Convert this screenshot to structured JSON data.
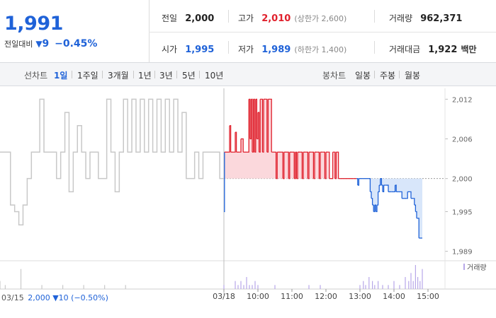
{
  "quote": {
    "price": "1,991",
    "change_label": "전일대비",
    "change_symbol": "▼",
    "change_value": "9",
    "change_percent": "−0.45%",
    "stats": [
      {
        "label": "전일",
        "value": "2,000",
        "value_color": "#222222",
        "extra": ""
      },
      {
        "label": "고가",
        "value": "2,010",
        "value_color": "#e0202c",
        "extra": "(상한가 2,600)"
      },
      {
        "label": "거래량",
        "value": "962,371",
        "value_color": "#222222",
        "extra": ""
      },
      {
        "label": "시가",
        "value": "1,995",
        "value_color": "#1f62d8",
        "extra": ""
      },
      {
        "label": "저가",
        "value": "1,989",
        "value_color": "#1f62d8",
        "extra": "(하한가 1,400)"
      },
      {
        "label": "거래대금",
        "value": "1,922",
        "value_color": "#222222",
        "extra": "백만"
      }
    ]
  },
  "line_chart_tabs": {
    "label": "선차트",
    "items": [
      "1일",
      "1주일",
      "3개월",
      "1년",
      "3년",
      "5년",
      "10년"
    ],
    "selected": "1일"
  },
  "candle_chart_tabs": {
    "label": "봉차트",
    "items": [
      "일봉",
      "주봉",
      "월봉"
    ]
  },
  "prev_day_info": {
    "date": "03/15",
    "close": "2,000",
    "change": "▼10",
    "change_percent": "(−0.50%)"
  },
  "colors": {
    "up": "#e0202c",
    "down": "#1f62d8",
    "prev_day_line": "#c8c8c8",
    "up_fill": "#fbd8dc",
    "down_fill": "#d8e6fa",
    "volume_bar": "#b7a7e8"
  },
  "chart_data": {
    "type": "line",
    "y_ticks": [
      "2,012",
      "2,006",
      "2,000",
      "1,995",
      "1,989"
    ],
    "y_tick_values": [
      2012,
      2006,
      2000,
      1995,
      1989
    ],
    "ylim": [
      1988,
      2013
    ],
    "x_ticks": [
      "03/18",
      "10:00",
      "11:00",
      "12:00",
      "13:00",
      "14:00",
      "15:00"
    ],
    "x_tick_minutes": [
      0,
      60,
      120,
      180,
      240,
      300,
      360
    ],
    "xlim_minutes": [
      0,
      390
    ],
    "reference_price": 2000,
    "volume_legend": "거래량",
    "previous_day_series": {
      "date": "03/15",
      "points": [
        [
          0,
          2004
        ],
        [
          6,
          2004
        ],
        [
          10,
          1996
        ],
        [
          14,
          1995
        ],
        [
          18,
          1993
        ],
        [
          22,
          1996
        ],
        [
          26,
          2000
        ],
        [
          30,
          2004
        ],
        [
          34,
          2004
        ],
        [
          38,
          2012
        ],
        [
          42,
          2004
        ],
        [
          46,
          2004
        ],
        [
          50,
          2004
        ],
        [
          54,
          2000
        ],
        [
          58,
          2004
        ],
        [
          62,
          2010
        ],
        [
          66,
          1998
        ],
        [
          70,
          2004
        ],
        [
          74,
          2008
        ],
        [
          78,
          2004
        ],
        [
          82,
          2000
        ],
        [
          86,
          2004
        ],
        [
          90,
          2004
        ],
        [
          94,
          2000
        ],
        [
          98,
          2000
        ],
        [
          102,
          2012
        ],
        [
          106,
          2004
        ],
        [
          110,
          1998
        ],
        [
          114,
          2004
        ],
        [
          118,
          2012
        ],
        [
          122,
          2004
        ],
        [
          126,
          2012
        ],
        [
          130,
          2004
        ],
        [
          134,
          2012
        ],
        [
          138,
          2004
        ],
        [
          142,
          2012
        ],
        [
          146,
          2004
        ],
        [
          150,
          2012
        ],
        [
          154,
          2004
        ],
        [
          158,
          2012
        ],
        [
          162,
          2004
        ],
        [
          166,
          2012
        ],
        [
          170,
          2004
        ],
        [
          174,
          2010
        ],
        [
          178,
          2000
        ],
        [
          182,
          2000
        ],
        [
          186,
          2004
        ],
        [
          190,
          2000
        ],
        [
          194,
          2004
        ],
        [
          198,
          2004
        ],
        [
          202,
          2004
        ],
        [
          206,
          2004
        ],
        [
          210,
          2000
        ],
        [
          214,
          2000
        ]
      ]
    },
    "today_series": {
      "date": "03/18",
      "points": [
        [
          0,
          1995
        ],
        [
          1,
          2004
        ],
        [
          8,
          2004
        ],
        [
          10,
          2008
        ],
        [
          12,
          2004
        ],
        [
          18,
          2004
        ],
        [
          20,
          2007
        ],
        [
          22,
          2004
        ],
        [
          28,
          2004
        ],
        [
          30,
          2006
        ],
        [
          34,
          2004
        ],
        [
          40,
          2004
        ],
        [
          44,
          2012
        ],
        [
          46,
          2006
        ],
        [
          48,
          2012
        ],
        [
          50,
          2004
        ],
        [
          52,
          2012
        ],
        [
          54,
          2004
        ],
        [
          56,
          2012
        ],
        [
          58,
          2006
        ],
        [
          60,
          2010
        ],
        [
          62,
          2004
        ],
        [
          64,
          2012
        ],
        [
          66,
          2012
        ],
        [
          68,
          2004
        ],
        [
          70,
          2012
        ],
        [
          74,
          2012
        ],
        [
          76,
          2004
        ],
        [
          78,
          2012
        ],
        [
          82,
          2012
        ],
        [
          84,
          2004
        ],
        [
          86,
          2004
        ],
        [
          90,
          2004
        ],
        [
          92,
          2000
        ],
        [
          94,
          2004
        ],
        [
          100,
          2004
        ],
        [
          104,
          2000
        ],
        [
          106,
          2004
        ],
        [
          110,
          2004
        ],
        [
          114,
          2000
        ],
        [
          116,
          2004
        ],
        [
          120,
          2004
        ],
        [
          124,
          2000
        ],
        [
          126,
          2004
        ],
        [
          128,
          2000
        ],
        [
          130,
          2004
        ],
        [
          136,
          2004
        ],
        [
          138,
          2000
        ],
        [
          140,
          2004
        ],
        [
          144,
          2004
        ],
        [
          148,
          2000
        ],
        [
          150,
          2004
        ],
        [
          154,
          2004
        ],
        [
          158,
          2000
        ],
        [
          160,
          2004
        ],
        [
          164,
          2004
        ],
        [
          168,
          2000
        ],
        [
          170,
          2004
        ],
        [
          174,
          2004
        ],
        [
          178,
          2000
        ],
        [
          180,
          2004
        ],
        [
          184,
          2004
        ],
        [
          186,
          2000
        ],
        [
          190,
          2000
        ],
        [
          192,
          2004
        ],
        [
          194,
          2004
        ],
        [
          196,
          2000
        ],
        [
          198,
          2004
        ],
        [
          200,
          2004
        ],
        [
          202,
          2000
        ],
        [
          206,
          2000
        ],
        [
          212,
          2000
        ],
        [
          220,
          2000
        ],
        [
          228,
          2000
        ],
        [
          234,
          2000
        ],
        [
          236,
          1999
        ],
        [
          238,
          2000
        ],
        [
          246,
          2000
        ],
        [
          252,
          2000
        ],
        [
          256,
          2000
        ],
        [
          258,
          1998
        ],
        [
          260,
          1997
        ],
        [
          262,
          1996
        ],
        [
          264,
          1995
        ],
        [
          266,
          1996
        ],
        [
          268,
          1995
        ],
        [
          270,
          1996
        ],
        [
          272,
          1998
        ],
        [
          274,
          1999
        ],
        [
          276,
          2000
        ],
        [
          278,
          1999
        ],
        [
          280,
          1998
        ],
        [
          282,
          1999
        ],
        [
          286,
          1999
        ],
        [
          290,
          1998
        ],
        [
          296,
          1998
        ],
        [
          300,
          1998
        ],
        [
          302,
          1999
        ],
        [
          304,
          1998
        ],
        [
          308,
          1998
        ],
        [
          312,
          1998
        ],
        [
          314,
          1997
        ],
        [
          318,
          1997
        ],
        [
          322,
          1997
        ],
        [
          324,
          1998
        ],
        [
          328,
          1998
        ],
        [
          330,
          1997
        ],
        [
          334,
          1997
        ],
        [
          336,
          1996
        ],
        [
          338,
          1995
        ],
        [
          340,
          1994
        ],
        [
          344,
          1991
        ],
        [
          350,
          1991
        ]
      ]
    },
    "volume": {
      "label": "거래량",
      "bars": [
        [
          0,
          1
        ],
        [
          20,
          2
        ],
        [
          25,
          1
        ],
        [
          30,
          2
        ],
        [
          35,
          1
        ],
        [
          40,
          3
        ],
        [
          45,
          1
        ],
        [
          50,
          1
        ],
        [
          55,
          2
        ],
        [
          60,
          1
        ],
        [
          90,
          1
        ],
        [
          150,
          1
        ],
        [
          170,
          1
        ],
        [
          240,
          1
        ],
        [
          246,
          2
        ],
        [
          250,
          1
        ],
        [
          256,
          3
        ],
        [
          262,
          2
        ],
        [
          266,
          1
        ],
        [
          272,
          2
        ],
        [
          280,
          1
        ],
        [
          290,
          1
        ],
        [
          300,
          2
        ],
        [
          310,
          1
        ],
        [
          320,
          3
        ],
        [
          326,
          2
        ],
        [
          330,
          4
        ],
        [
          334,
          2
        ],
        [
          338,
          6
        ],
        [
          342,
          3
        ],
        [
          346,
          2
        ],
        [
          350,
          5
        ]
      ],
      "prev_day_bars": [
        [
          0,
          2
        ],
        [
          5,
          1
        ],
        [
          20,
          5
        ],
        [
          40,
          1
        ],
        [
          60,
          1
        ],
        [
          80,
          1
        ],
        [
          100,
          1
        ],
        [
          120,
          1
        ]
      ]
    }
  }
}
